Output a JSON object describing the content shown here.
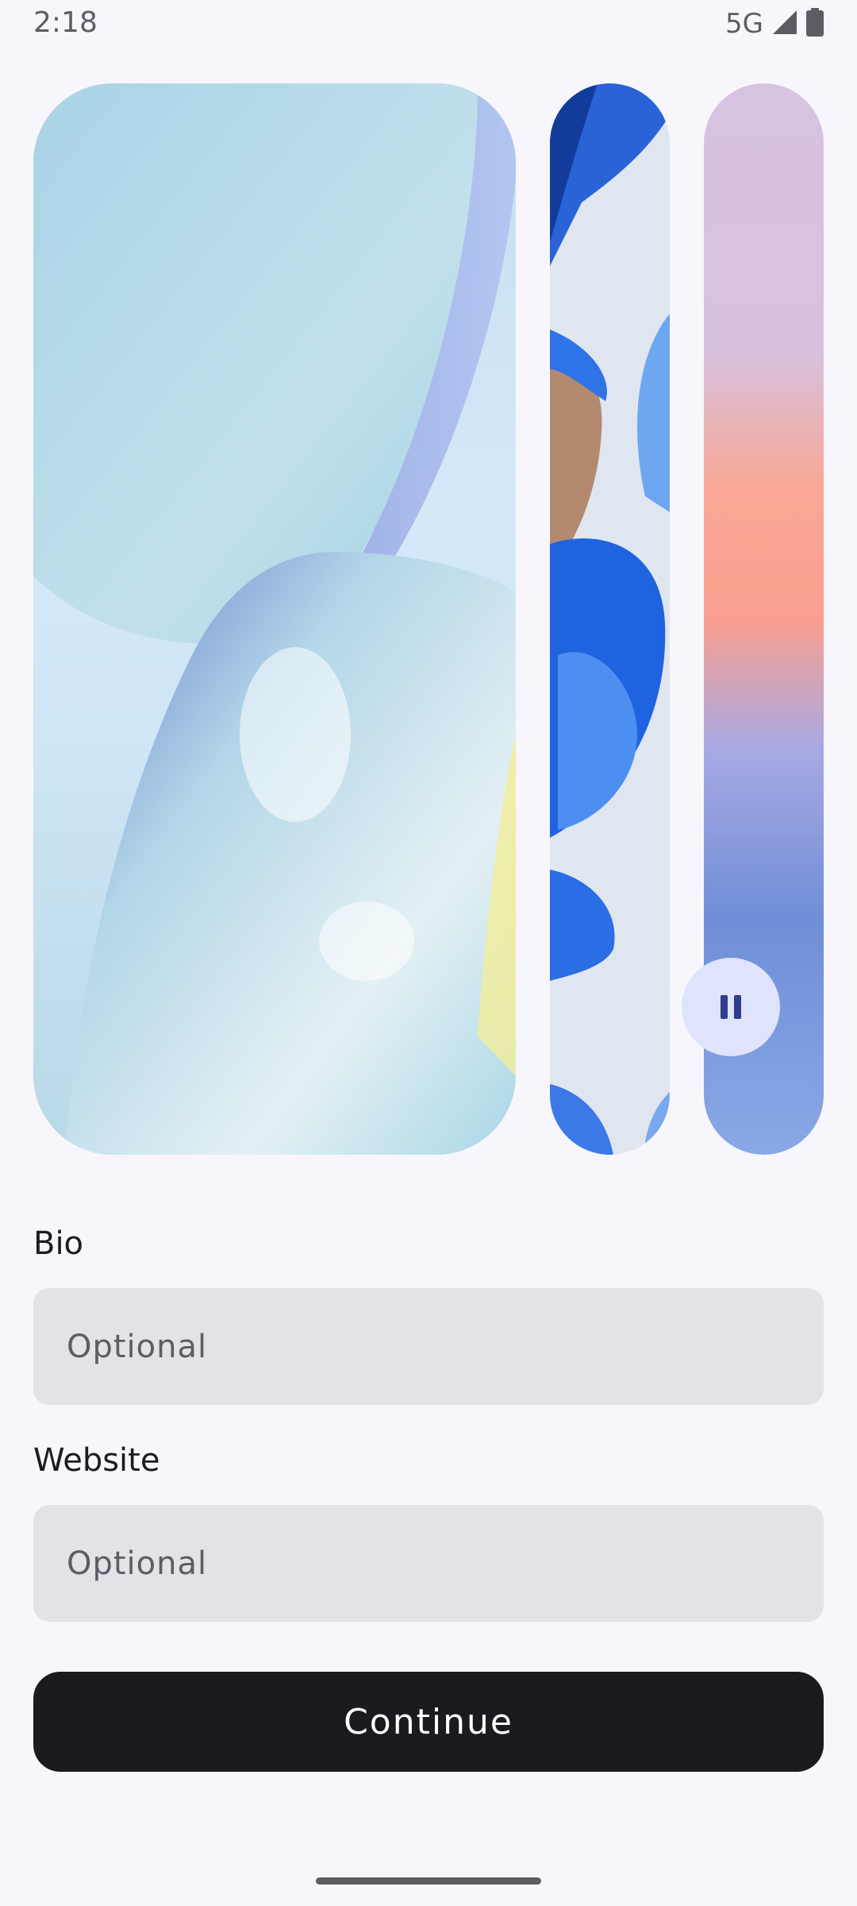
{
  "status_bar": {
    "time": "2:18",
    "network": "5G",
    "icons": [
      "signal-icon",
      "battery-icon"
    ]
  },
  "carousel": {
    "items": [
      {
        "name": "wallpaper-card-abstract-blue"
      },
      {
        "name": "wallpaper-card-blue-rings"
      },
      {
        "name": "wallpaper-card-gradient"
      }
    ],
    "pause_icon": "pause-icon"
  },
  "form": {
    "bio": {
      "label": "Bio",
      "placeholder": "Optional",
      "value": ""
    },
    "website": {
      "label": "Website",
      "placeholder": "Optional",
      "value": ""
    }
  },
  "actions": {
    "continue_label": "Continue"
  },
  "colors": {
    "background": "#f8f6fd",
    "field_background": "#e3e2e8",
    "primary_button": "#1b1b1f",
    "pause_button": "#dfe3fb",
    "pause_icon": "#2f3d8a"
  }
}
